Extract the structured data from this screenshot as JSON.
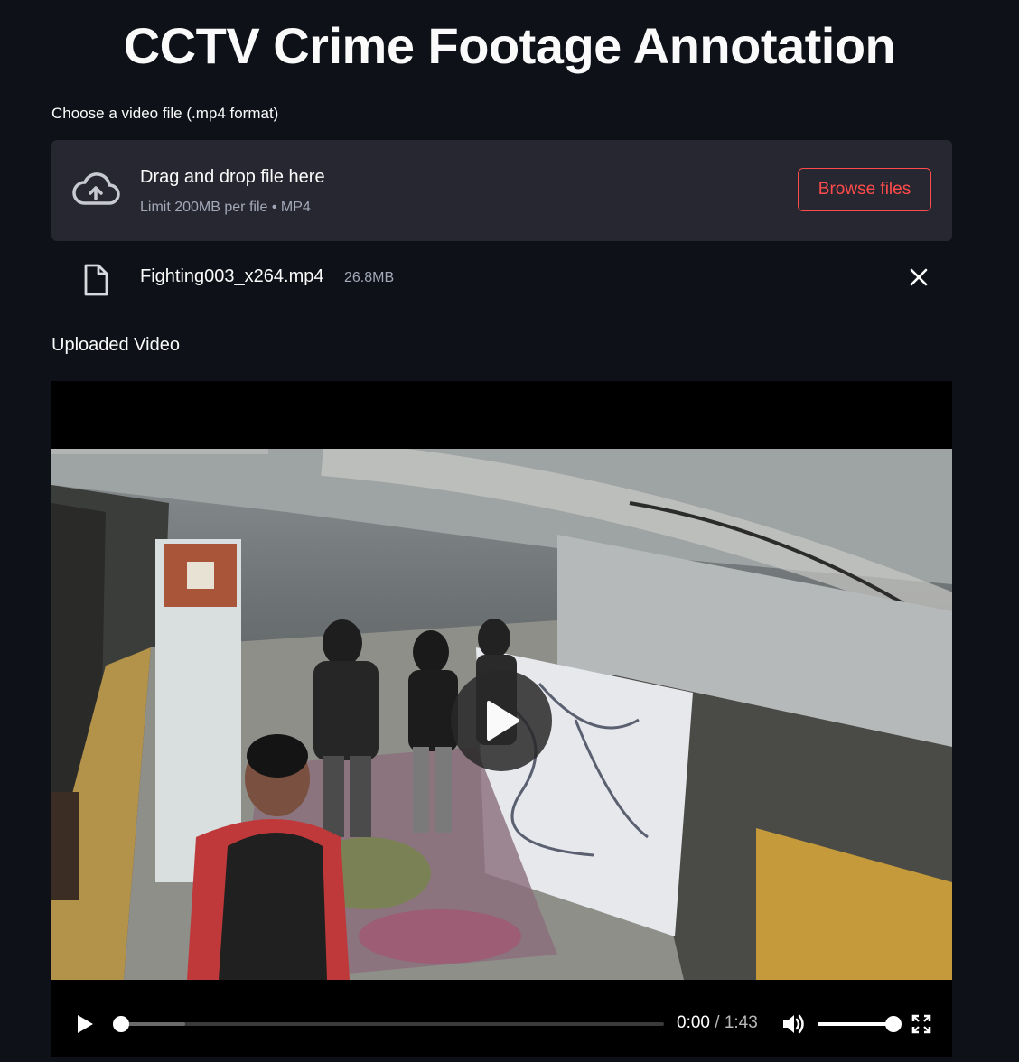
{
  "page": {
    "title": "CCTV Crime Footage Annotation"
  },
  "uploader": {
    "label": "Choose a video file (.mp4 format)",
    "drop_text": "Drag and drop file here",
    "drop_hint": "Limit 200MB per file • MP4",
    "browse_label": "Browse files",
    "icon": "cloud-upload-icon",
    "accent_color": "#ff4b4b"
  },
  "uploaded_file": {
    "name": "Fighting003_x264.mp4",
    "size": "26.8MB",
    "icon": "file-icon",
    "remove_icon": "close-icon"
  },
  "video_section": {
    "label": "Uploaded Video",
    "player": {
      "current_time": "0:00",
      "separator": " / ",
      "duration": "1:43",
      "progress": 0.0,
      "buffered": 0.12,
      "volume": 1.0,
      "icons": [
        "play-icon",
        "volume-icon",
        "fullscreen-icon",
        "play-overlay-icon"
      ]
    }
  }
}
